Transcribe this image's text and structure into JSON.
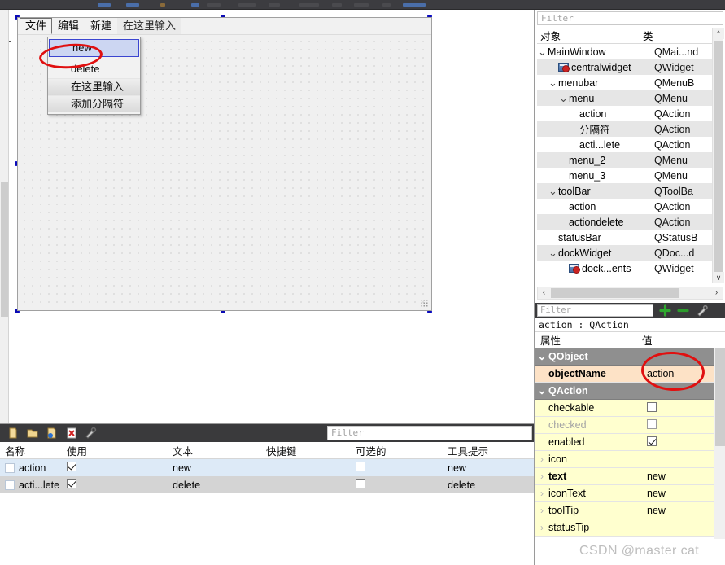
{
  "app_toolbar": {
    "name": "qt-designer-toolbar"
  },
  "form_preview": {
    "menubar": [
      {
        "label": "文件",
        "state": "active"
      },
      {
        "label": "编辑",
        "state": "normal"
      },
      {
        "label": "新建",
        "state": "normal"
      },
      {
        "label": "在这里输入",
        "state": "placeholder"
      }
    ],
    "open_menu": {
      "items": [
        {
          "label": "new",
          "state": "selected"
        },
        {
          "label": "delete",
          "state": "normal"
        },
        {
          "label": "在这里输入",
          "state": "hint"
        },
        {
          "label": "添加分隔符",
          "state": "hint"
        }
      ]
    }
  },
  "action_editor": {
    "toolbar": {
      "icons": [
        "new-action-icon",
        "open-folder-icon",
        "edit-action-icon",
        "delete-action-icon",
        "configure-icon"
      ],
      "filter_placeholder": "Filter"
    },
    "columns": [
      "名称",
      "使用",
      "文本",
      "快捷键",
      "可选的",
      "工具提示"
    ],
    "rows": [
      {
        "name": "action",
        "used": true,
        "text": "new",
        "shortcut": "",
        "checkable": false,
        "tooltip": "new"
      },
      {
        "name": "acti...lete",
        "used": true,
        "text": "delete",
        "shortcut": "",
        "checkable": false,
        "tooltip": "delete"
      }
    ]
  },
  "object_inspector": {
    "filter_placeholder": "Filter",
    "columns": [
      "对象",
      "类"
    ],
    "rows": [
      {
        "indent": 0,
        "chevron": "down",
        "icon": "",
        "name": "MainWindow",
        "class": "QMai...nd",
        "alt": false
      },
      {
        "indent": 1,
        "chevron": "",
        "icon": "widget-icon",
        "name": "centralwidget",
        "class": "QWidget",
        "alt": true
      },
      {
        "indent": 1,
        "chevron": "down",
        "icon": "",
        "name": "menubar",
        "class": "QMenuB",
        "alt": false
      },
      {
        "indent": 2,
        "chevron": "down",
        "icon": "",
        "name": "menu",
        "class": "QMenu",
        "alt": true
      },
      {
        "indent": 3,
        "chevron": "",
        "icon": "",
        "name": "action",
        "class": "QAction",
        "alt": false
      },
      {
        "indent": 3,
        "chevron": "",
        "icon": "",
        "name": "分隔符",
        "class": "QAction",
        "alt": true
      },
      {
        "indent": 3,
        "chevron": "",
        "icon": "",
        "name": "acti...lete",
        "class": "QAction",
        "alt": false
      },
      {
        "indent": 2,
        "chevron": "",
        "icon": "",
        "name": "menu_2",
        "class": "QMenu",
        "alt": true
      },
      {
        "indent": 2,
        "chevron": "",
        "icon": "",
        "name": "menu_3",
        "class": "QMenu",
        "alt": false
      },
      {
        "indent": 1,
        "chevron": "down",
        "icon": "",
        "name": "toolBar",
        "class": "QToolBa",
        "alt": true
      },
      {
        "indent": 2,
        "chevron": "",
        "icon": "",
        "name": "action",
        "class": "QAction",
        "alt": false
      },
      {
        "indent": 2,
        "chevron": "",
        "icon": "",
        "name": "actiondelete",
        "class": "QAction",
        "alt": true
      },
      {
        "indent": 1,
        "chevron": "",
        "icon": "",
        "name": "statusBar",
        "class": "QStatusB",
        "alt": false
      },
      {
        "indent": 1,
        "chevron": "down",
        "icon": "",
        "name": "dockWidget",
        "class": "QDoc...d",
        "alt": true
      },
      {
        "indent": 2,
        "chevron": "",
        "icon": "widget-icon",
        "name": "dock...ents",
        "class": "QWidget",
        "alt": false
      }
    ]
  },
  "property_editor": {
    "filter_placeholder": "Filter",
    "buttons": [
      "add-property-icon",
      "remove-property-icon",
      "configure-property-icon"
    ],
    "object_line": "action : QAction",
    "columns": [
      "属性",
      "值"
    ],
    "rows": [
      {
        "kind": "group",
        "expander": "down",
        "key": "QObject",
        "value": ""
      },
      {
        "kind": "highlight",
        "expander": "",
        "key": "objectName",
        "value": "action"
      },
      {
        "kind": "group",
        "expander": "down",
        "key": "QAction",
        "value": ""
      },
      {
        "kind": "yellow",
        "expander": "",
        "key": "checkable",
        "value": "",
        "checkbox": "unchecked"
      },
      {
        "kind": "disabled",
        "expander": "",
        "key": "checked",
        "value": "",
        "checkbox": "unchecked"
      },
      {
        "kind": "yellow",
        "expander": "",
        "key": "enabled",
        "value": "",
        "checkbox": "checked"
      },
      {
        "kind": "yellow",
        "expander": "right",
        "key": "icon",
        "value": ""
      },
      {
        "kind": "yellow",
        "expander": "right",
        "key": "text",
        "value": "new",
        "bold": true
      },
      {
        "kind": "yellow",
        "expander": "right",
        "key": "iconText",
        "value": "new"
      },
      {
        "kind": "yellow",
        "expander": "right",
        "key": "toolTip",
        "value": "new"
      },
      {
        "kind": "yellow",
        "expander": "right",
        "key": "statusTip",
        "value": ""
      }
    ]
  },
  "annotations": {
    "ellipse_new": "red-ellipse-over-new-menu-item",
    "ellipse_objectname": "red-ellipse-over-objectname-value"
  },
  "watermark": {
    "text": "CSDN @master cat"
  },
  "colors": {
    "selection_blue": "#ccd6f2",
    "annotation_red": "#e01010",
    "group_header_gray": "#8f8f8f",
    "highlight_peach": "#fde2c6",
    "property_yellow": "#ffffcf",
    "dark_toolbar": "#3a3a3c",
    "row_selected_blue": "#ddeaf7",
    "row_alt_gray": "#d4d4d4"
  }
}
